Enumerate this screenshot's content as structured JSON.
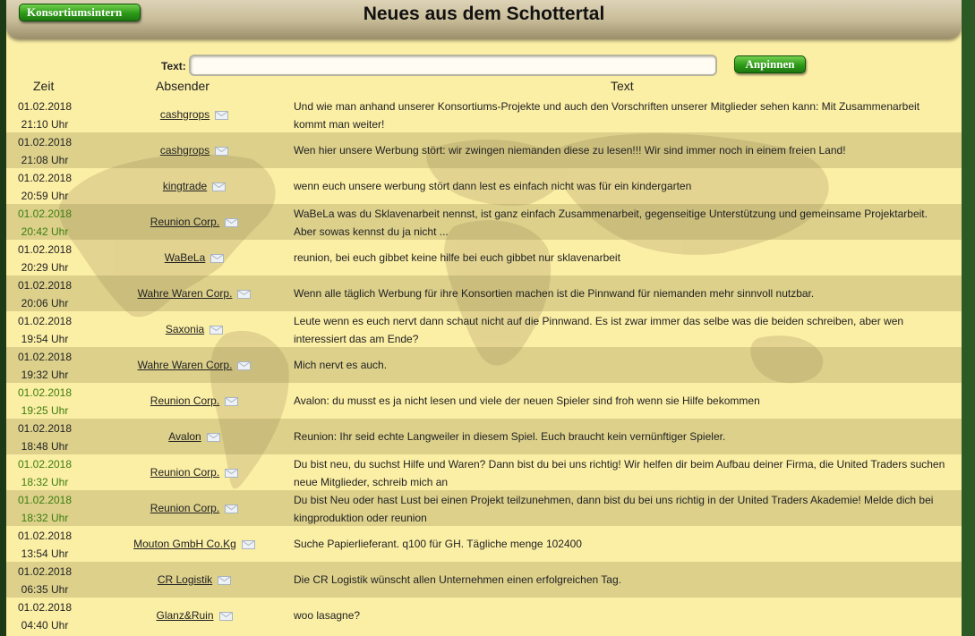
{
  "header": {
    "title": "Neues aus dem Schottertal",
    "konsortium_button": "Konsortiumsintern"
  },
  "form": {
    "text_label": "Text:",
    "text_value": "",
    "pin_button": "Anpinnen"
  },
  "columns": {
    "time": "Zeit",
    "sender": "Absender",
    "text": "Text"
  },
  "messages": [
    {
      "date": "01.02.2018",
      "time": "21:10 Uhr",
      "sender": "cashgrops",
      "text": "Und wie man anhand unserer Konsortiums-Projekte und auch den Vorschriften unserer Mitglieder sehen kann: Mit Zusammenarbeit kommt man weiter!"
    },
    {
      "date": "01.02.2018",
      "time": "21:08 Uhr",
      "sender": "cashgrops",
      "text": "Wen hier unsere Werbung stört: wir zwingen niemanden diese zu lesen!!! Wir sind immer noch in einem freien Land!"
    },
    {
      "date": "01.02.2018",
      "time": "20:59 Uhr",
      "sender": "kingtrade",
      "text": "wenn euch unsere werbung stört dann lest es einfach nicht was für ein kindergarten"
    },
    {
      "date": "01.02.2018",
      "time": "20:42 Uhr",
      "sender": "Reunion Corp.",
      "text": "WaBeLa was du Sklavenarbeit nennst, ist ganz einfach Zusammenarbeit, gegenseitige Unterstützung und gemeinsame Projektarbeit. Aber sowas kennst du ja nicht ..."
    },
    {
      "date": "01.02.2018",
      "time": "20:29 Uhr",
      "sender": "WaBeLa",
      "text": "reunion, bei euch gibbet keine hilfe bei euch gibbet nur sklavenarbeit"
    },
    {
      "date": "01.02.2018",
      "time": "20:06 Uhr",
      "sender": "Wahre Waren Corp.",
      "text": "Wenn alle täglich Werbung für ihre Konsortien machen ist die Pinnwand für niemanden mehr sinnvoll nutzbar."
    },
    {
      "date": "01.02.2018",
      "time": "19:54 Uhr",
      "sender": "Saxonia",
      "text": "Leute wenn es euch nervt dann schaut nicht auf die Pinnwand. Es ist zwar immer das selbe was die beiden schreiben, aber wen interessiert das am Ende?"
    },
    {
      "date": "01.02.2018",
      "time": "19:32 Uhr",
      "sender": "Wahre Waren Corp.",
      "text": "Mich nervt es auch."
    },
    {
      "date": "01.02.2018",
      "time": "19:25 Uhr",
      "sender": "Reunion Corp.",
      "text": "Avalon: du musst es ja nicht lesen und viele der neuen Spieler sind froh wenn sie Hilfe bekommen"
    },
    {
      "date": "01.02.2018",
      "time": "18:48 Uhr",
      "sender": "Avalon",
      "text": "Reunion: Ihr seid echte Langweiler in diesem Spiel. Euch braucht kein vernünftiger Spieler."
    },
    {
      "date": "01.02.2018",
      "time": "18:32 Uhr",
      "sender": "Reunion Corp.",
      "text": "Du bist neu, du suchst Hilfe und Waren? Dann bist du bei uns richtig! Wir helfen dir beim Aufbau deiner Firma, die United Traders suchen neue Mitglieder, schreib mich an"
    },
    {
      "date": "01.02.2018",
      "time": "18:32 Uhr",
      "sender": "Reunion Corp.",
      "text": "Du bist Neu oder hast Lust bei einen Projekt teilzunehmen, dann bist du bei uns richtig in der United Traders Akademie! Melde dich bei kingproduktion oder reunion"
    },
    {
      "date": "01.02.2018",
      "time": "13:54 Uhr",
      "sender": "Mouton GmbH Co.Kg",
      "text": "Suche Papierlieferant. q100 für GH. Tägliche menge 102400"
    },
    {
      "date": "01.02.2018",
      "time": "06:35 Uhr",
      "sender": "CR Logistik",
      "text": "Die CR Logistik wünscht allen Unternehmen einen erfolgreichen Tag."
    },
    {
      "date": "01.02.2018",
      "time": "04:40 Uhr",
      "sender": "Glanz&Ruin",
      "text": "woo lasagne?"
    }
  ]
}
